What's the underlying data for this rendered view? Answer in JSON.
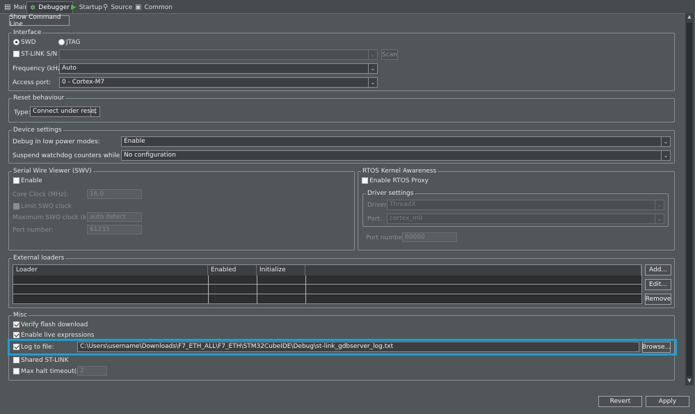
{
  "tabs": [
    {
      "label": "Main",
      "icon": "main-icon"
    },
    {
      "label": "Debugger",
      "icon": "debugger-icon"
    },
    {
      "label": "Startup",
      "icon": "startup-icon"
    },
    {
      "label": "Source",
      "icon": "source-icon"
    },
    {
      "label": "Common",
      "icon": "common-icon"
    }
  ],
  "show_command_line": "Show Command Line",
  "interface": {
    "title": "Interface",
    "swd": "SWD",
    "jtag": "JTAG",
    "stlink_sn": "ST-LINK S/N",
    "scan": "Scan",
    "frequency_label": "Frequency (kHz):",
    "frequency_value": "Auto",
    "access_port_label": "Access port:",
    "access_port_value": "0 - Cortex-M7"
  },
  "reset": {
    "title": "Reset behaviour",
    "type_label": "Type:",
    "type_value": "Connect under reset"
  },
  "device": {
    "title": "Device settings",
    "low_power_label": "Debug in low power modes:",
    "low_power_value": "Enable",
    "watchdog_label": "Suspend watchdog counters while halted:",
    "watchdog_value": "No configuration"
  },
  "swv": {
    "title": "Serial Wire Viewer (SWV)",
    "enable": "Enable",
    "core_clock_label": "Core Clock (MHz):",
    "core_clock_value": "16.0",
    "limit_swo": "Limit SWO clock",
    "max_swo_label": "Maximum SWO clock (kHz):",
    "max_swo_value": "auto detect",
    "port_label": "Port number:",
    "port_value": "61235"
  },
  "rtos": {
    "title": "RTOS Kernel Awareness",
    "enable_proxy": "Enable RTOS Proxy",
    "driver_settings": "Driver settings",
    "driver_label": "Driver:",
    "driver_value": "ThreadX",
    "port_label": "Port:",
    "port_value": "cortex_m0",
    "port_number_label": "Port number:",
    "port_number_value": "60000"
  },
  "loaders": {
    "title": "External loaders",
    "columns": [
      "Loader",
      "Enabled",
      "Initialize"
    ],
    "add": "Add...",
    "edit": "Edit...",
    "remove": "Remove"
  },
  "misc": {
    "title": "Misc",
    "verify_flash": "Verify flash download",
    "live_expr": "Enable live expressions",
    "log_label": "Log to file:",
    "log_path": "C:\\Users\\username\\Downloads\\F7_ETH_ALL\\F7_ETH\\STM32CubeIDE\\Debug\\st-link_gdbserver_log.txt",
    "browse": "Browse...",
    "shared_stlink": "Shared ST-LINK",
    "max_halt_label": "Max halt timeout(s):",
    "max_halt_value": "2"
  },
  "footer": {
    "revert": "Revert",
    "apply": "Apply"
  },
  "colors": {
    "background": "#515658",
    "highlight": "#1a9fd9"
  }
}
